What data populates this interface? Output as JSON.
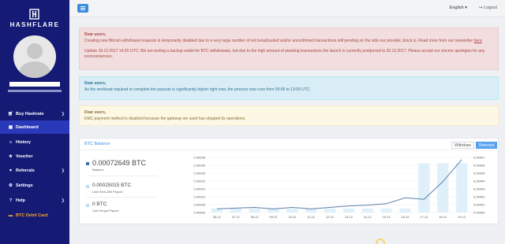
{
  "brand": {
    "name": "HASHFLARE"
  },
  "sidebar": {
    "items": [
      {
        "label": "Buy Hashrate",
        "icon": "cart-icon",
        "has_caret": true
      },
      {
        "label": "Dashboard",
        "icon": "dashboard-icon",
        "active": true
      },
      {
        "label": "History",
        "icon": "history-icon"
      },
      {
        "label": "Voucher",
        "icon": "star-icon"
      },
      {
        "label": "Referrals",
        "icon": "referrals-icon",
        "has_caret": true
      },
      {
        "label": "Settings",
        "icon": "gear-icon"
      },
      {
        "label": "Help",
        "icon": "question-icon",
        "has_caret": true
      },
      {
        "label": "BTC Debit Card",
        "icon": "card-icon",
        "highlight": true
      }
    ]
  },
  "topbar": {
    "language": "English",
    "logout": "Logout"
  },
  "alerts": {
    "danger": {
      "title": "Dear users,",
      "p1_before": "Creating new Bitcoin withdrawal requests is temporarily disabled due to a very large number of not broadcasted and/or unconfirmed transactions still pending on the side our provider, block.io. Read more from our newsletter ",
      "p1_link": "here",
      "p1_after": ".",
      "p2": "Update 18.12.2017 14:20 UTC: We are testing a backup wallet for BTC withdrawals, but due to the high amount of awaiting transactions the launch is currently postponed to 20.12.2017. Please accept our sincere apologies for any inconveniences."
    },
    "info": {
      "title": "Dear users,",
      "text": "As the workload required to complete the payouts is significantly higher right now, the process now runs from 00:00 to 13:00 UTC."
    },
    "warning": {
      "title": "Dear users,",
      "text": "EMC payment method is disabled because the gateway we used has stopped its operations."
    }
  },
  "btc_card": {
    "title": "BTC Balance",
    "tabs": {
      "withdraw": "Withdraw",
      "reinvest": "Reinvest"
    },
    "stats": [
      {
        "value": "0.00072649 BTC",
        "label": "Balance",
        "color": "#3c6fb0"
      },
      {
        "value": "0.00025015 BTC",
        "label": "Last SHA-256 Payout",
        "color": "#b9dcf5"
      },
      {
        "value": "0 BTC",
        "label": "Last Scrypt Payout",
        "color": "#b9dcf5"
      }
    ]
  },
  "chart_data": {
    "type": "bar",
    "categories": [
      "06.12",
      "07.12",
      "08.12",
      "09.12",
      "10.12",
      "11.12",
      "12.12",
      "13.12",
      "14.12",
      "15.12",
      "16.12",
      "17.12",
      "18.12",
      "19.12"
    ],
    "series": [
      {
        "type": "line",
        "axis": "left",
        "color": "#5b7fa6",
        "values": [
          5e-05,
          6e-05,
          7e-05,
          5e-05,
          7e-05,
          5e-05,
          7e-05,
          9e-05,
          0.0001,
          0.00012,
          0.0002,
          0.00018,
          0.00042,
          0.00072
        ]
      },
      {
        "type": "bar",
        "axis": "right",
        "color": "#dff0fb",
        "values": [
          2e-05,
          2e-05,
          2e-05,
          2e-05,
          2e-05,
          2e-05,
          2e-05,
          2e-05,
          2e-05,
          2e-05,
          2e-05,
          0.00025,
          0.00025,
          0.00025
        ]
      }
    ],
    "y_left": {
      "ticks": [
        "0.00000",
        "0.00005",
        "0.00010",
        "0.00015",
        "0.00020",
        "0.00025",
        "0.00030",
        "0.00035"
      ],
      "min": 0,
      "max": 0.00075
    },
    "y_right": {
      "ticks": [
        "0.00000",
        "0.00001",
        "0.00002",
        "0.00003",
        "0.00004",
        "0.00005",
        "0.00006",
        "0.00007"
      ],
      "min": 0,
      "max": 0.00028
    }
  }
}
